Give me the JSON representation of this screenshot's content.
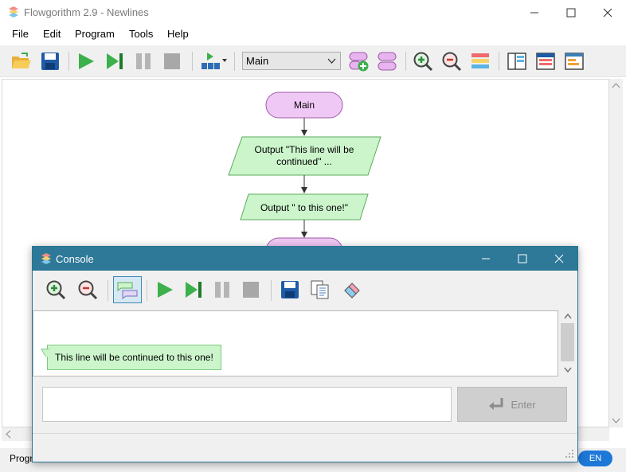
{
  "window": {
    "title": "Flowgorithm 2.9 - Newlines",
    "minimize": "—",
    "maximize": "☐",
    "close": "✕"
  },
  "menu": [
    "File",
    "Edit",
    "Program",
    "Tools",
    "Help"
  ],
  "toolbar": {
    "function_select": "Main",
    "icons": [
      "open-folder-icon",
      "save-icon",
      "run-icon",
      "step-icon",
      "pause-icon",
      "stop-icon",
      "run-mode-icon",
      "add-function-icon",
      "function-icon",
      "zoom-in-icon",
      "zoom-out-icon",
      "layout-icon",
      "panel-icon",
      "variables-icon",
      "chart-icon"
    ]
  },
  "flowchart": {
    "start": "Main",
    "output1_line1": "Output \"This line will be",
    "output1_line2": "continued\" ...",
    "output2": "Output \" to this one!\""
  },
  "status_text": "Progr",
  "language_badge": "EN",
  "console": {
    "title": "Console",
    "output_text": "This line will be continued to this one!",
    "enter_label": "Enter",
    "colors": {
      "titlebar": "#2e7898",
      "bubble": "#ccf5cc"
    }
  },
  "colors": {
    "terminal_fill": "#f0c8f5",
    "output_fill": "#ccf5cc",
    "toolbar_green": "#3cb04a"
  }
}
